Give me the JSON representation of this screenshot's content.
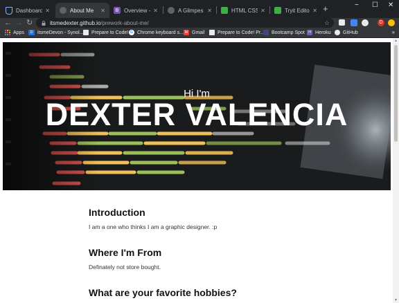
{
  "browser": {
    "tabs": [
      {
        "label": "Dashboard | Bo",
        "favicon": "shield-icon",
        "active": false
      },
      {
        "label": "About Me",
        "favicon": "globe-icon",
        "active": true
      },
      {
        "label": "Overview - Boot",
        "favicon": "bootstrap-icon",
        "active": false
      },
      {
        "label": "A Glimpes of m",
        "favicon": "globe-icon",
        "active": false
      },
      {
        "label": "HTML CSS",
        "favicon": "trinket-icon",
        "active": false
      },
      {
        "label": "Tryit Editor v3.6",
        "favicon": "trinket-icon",
        "active": false
      }
    ],
    "new_tab": "+",
    "window_controls": {
      "minimize": "−",
      "maximize": "☐",
      "close": "✕"
    },
    "address": {
      "host": "itsmedexter.github.io",
      "path": "/prework-about-me/"
    },
    "profile_initial": "D",
    "bookmarks": [
      {
        "label": "Apps",
        "icon": "apps-grid-icon"
      },
      {
        "label": "itsmeDevon - Synol...",
        "icon": "dsm-icon"
      },
      {
        "label": "Prepare to Code!",
        "icon": "page-icon"
      },
      {
        "label": "Chrome keyboard s...",
        "icon": "google-icon"
      },
      {
        "label": "Gmail",
        "icon": "gmail-icon"
      },
      {
        "label": "Prepare to Code! Pr...",
        "icon": "page-icon"
      },
      {
        "label": "Bootcamp Spot",
        "icon": "bootcamp-icon"
      },
      {
        "label": "Heroku",
        "icon": "heroku-icon"
      },
      {
        "label": "GitHub",
        "icon": "github-icon"
      }
    ],
    "bookmarks_more": "»"
  },
  "page": {
    "hero": {
      "greeting": "Hi I'm",
      "name": "DEXTER VALENCIA"
    },
    "sections": [
      {
        "heading": "Introduction",
        "body": "I am a one who thinks I am a graphic designer. :p"
      },
      {
        "heading": "Where I'm From",
        "body": "Definately not store bought."
      },
      {
        "heading": "What are your favorite hobbies?",
        "body": ""
      }
    ]
  },
  "colors": {
    "chrome_dark": "#202124",
    "chrome_toolbar": "#35363a",
    "page_bg": "#ffffff",
    "hero_bg": "#151515"
  }
}
